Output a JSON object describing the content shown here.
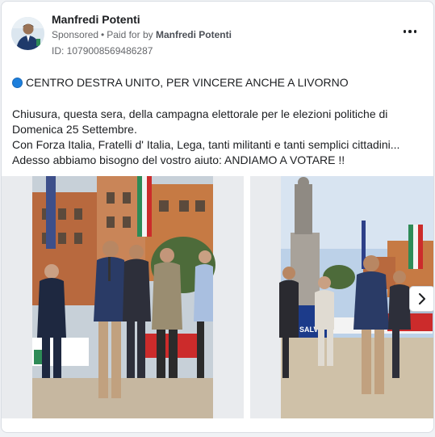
{
  "post": {
    "author": "Manfredi Potenti",
    "sponsored_label": "Sponsored",
    "separator": "•",
    "paid_for_prefix": "Paid for by",
    "paid_for_by": "Manfredi Potenti",
    "ad_id": "ID: 1079008569486287",
    "more_icon": "more-horizontal-icon",
    "headline_icon": "blue-circle-icon",
    "headline": "CENTRO DESTRA UNITO, PER VINCERE ANCHE A LIVORNO",
    "body_lines": [
      "Chiusura, questa sera, della campagna elettorale per le elezioni politiche di Domenica 25 Settembre.",
      "Con Forza Italia, Fratelli d' Italia, Lega, tanti militanti e tanti semplici cittadini...",
      "Adesso abbiamo bisogno del vostro aiuto: ANDIAMO A VOTARE !!"
    ]
  },
  "carousel": {
    "next_icon": "chevron-right-icon",
    "slides": [
      {
        "name": "photo-speakers-at-rally"
      },
      {
        "name": "photo-speaker-at-monument"
      }
    ],
    "banner_text": "SALVI"
  },
  "colors": {
    "accent": "#1d7fdc",
    "text_primary": "#1c1e21",
    "text_secondary": "#65676b"
  }
}
